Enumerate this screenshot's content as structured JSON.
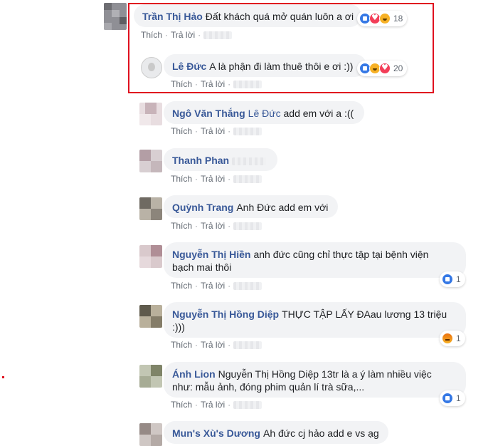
{
  "ui": {
    "like_label": "Thích",
    "reply_label": "Trả lời",
    "sep": "·"
  },
  "colors": {
    "name": "#385898",
    "bubble": "#f2f3f5",
    "highlight": "#e0101f"
  },
  "comments": [
    {
      "name": "Trần Thị Hảo",
      "text": "Đất khách quá mở quán luôn a ơi",
      "reactions": [
        "like-icon",
        "love-icon",
        "haha-icon"
      ],
      "count": "18"
    },
    {
      "name": "Lê Đức",
      "text": "A là phận đi làm thuê thôi e ơi :))",
      "reactions": [
        "like-icon",
        "haha-icon",
        "love-icon"
      ],
      "count": "20"
    },
    {
      "name": "Ngô Văn Thắng",
      "mention": "Lê Đức",
      "text": "add em với a :(("
    },
    {
      "name": "Thanh Phan",
      "text": ""
    },
    {
      "name": "Quỳnh Trang",
      "text": "Anh Đức add em với"
    },
    {
      "name": "Nguyễn Thị Hiền",
      "text": "anh đức cũng chỉ thực tập tại bệnh viện bạch mai thôi",
      "reactions": [
        "like-icon"
      ],
      "count": "1"
    },
    {
      "name": "Nguyễn Thị Hồng Diệp",
      "text": "THỰC TẬP LẤY ĐAau lương 13 triệu :)))",
      "reactions": [
        "angry-icon"
      ],
      "count": "1"
    },
    {
      "name": "Ánh Lion",
      "text": "Nguyễn Thị Hồng Diệp 13tr là a ý làm nhiều việc như: mẫu ảnh, đóng phim quản lí trà sữa,...",
      "reactions": [
        "like-icon"
      ],
      "count": "1"
    },
    {
      "name": "Mun's Xù's Dương",
      "text": "Ah đức cj hảo add e vs ạg"
    }
  ]
}
